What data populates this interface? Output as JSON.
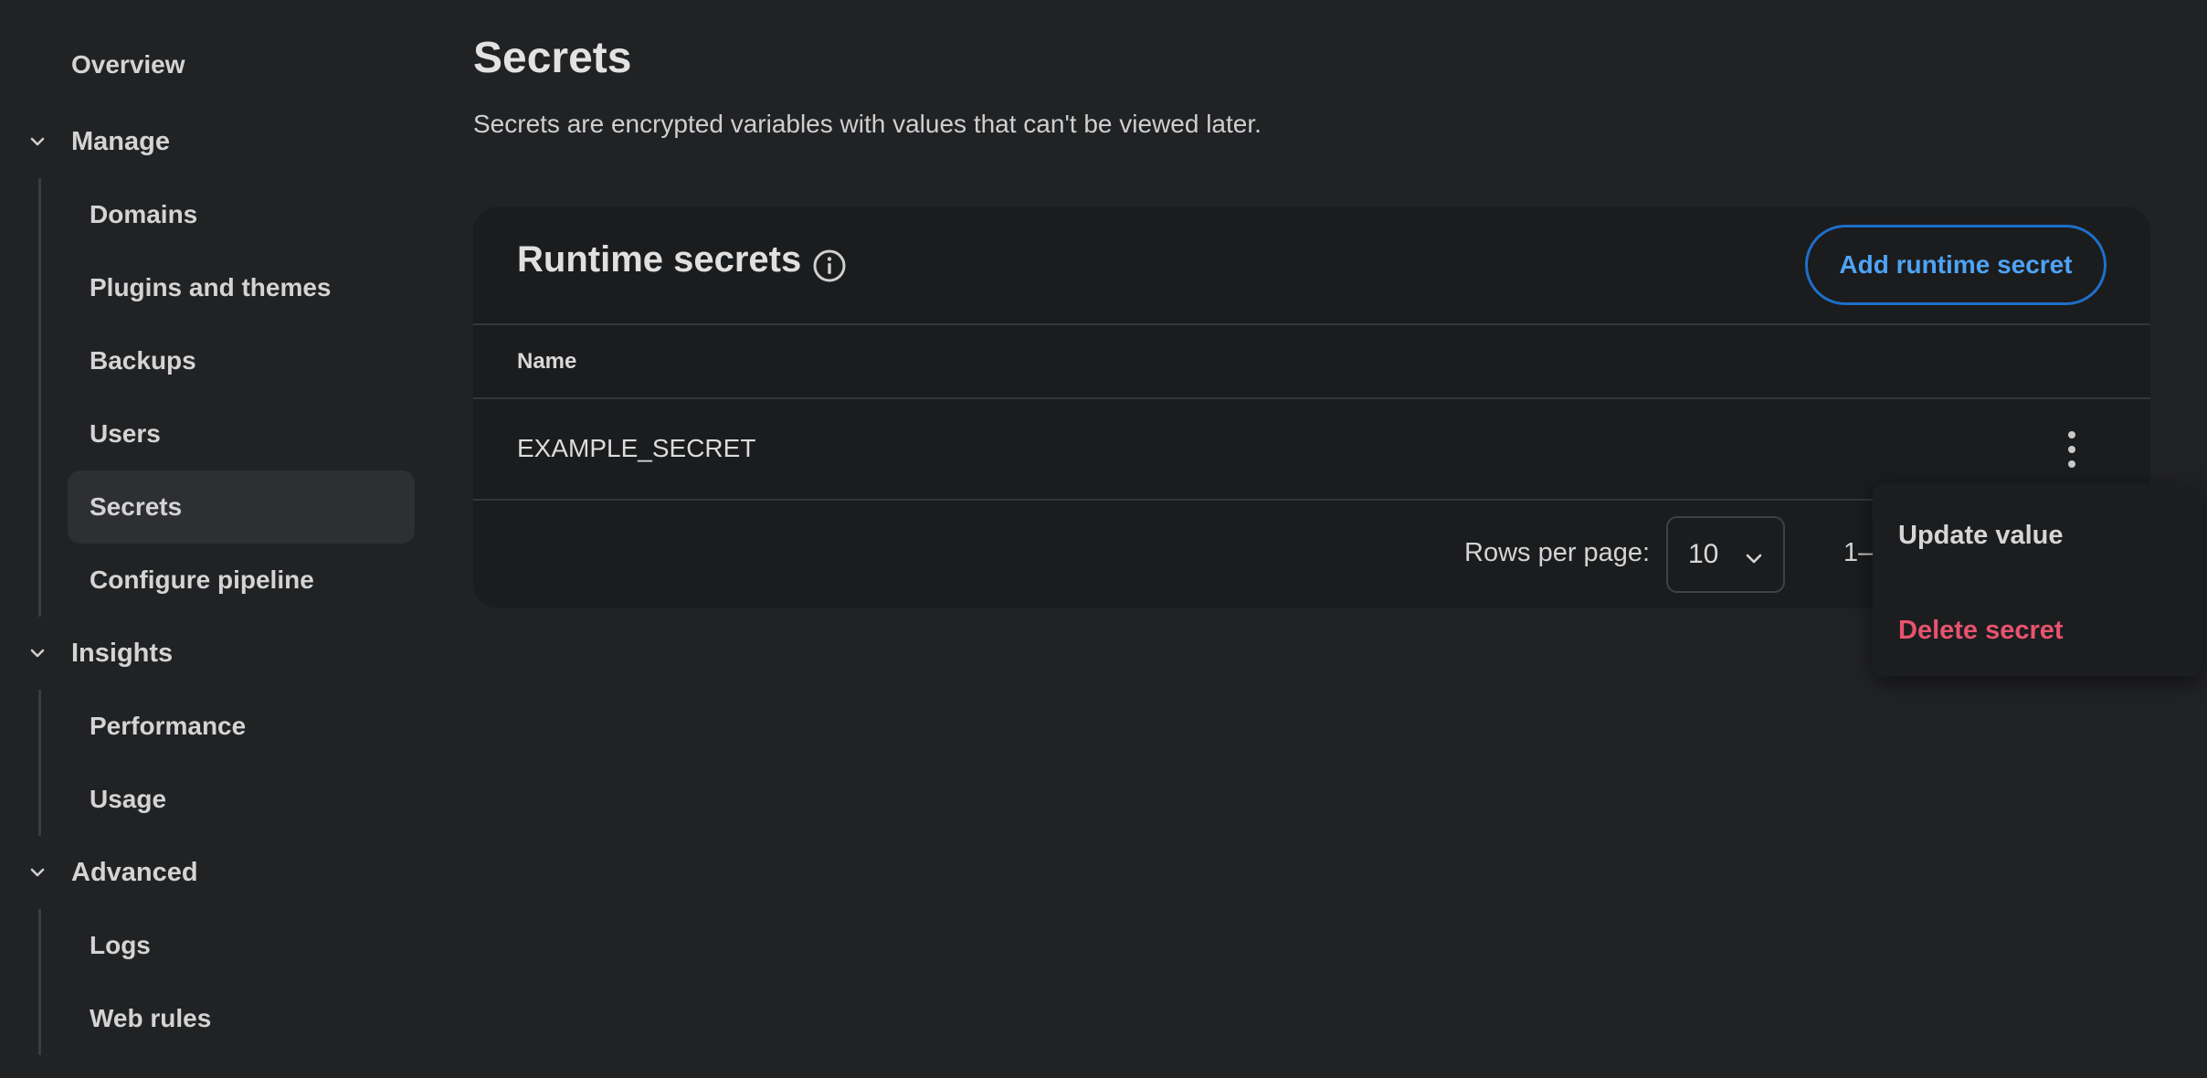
{
  "sidebar": {
    "overview": "Overview",
    "groups": [
      {
        "label": "Manage",
        "items": [
          "Domains",
          "Plugins and themes",
          "Backups",
          "Users",
          "Secrets",
          "Configure pipeline"
        ]
      },
      {
        "label": "Insights",
        "items": [
          "Performance",
          "Usage"
        ]
      },
      {
        "label": "Advanced",
        "items": [
          "Logs",
          "Web rules"
        ]
      }
    ],
    "active_item": "Secrets"
  },
  "page": {
    "title": "Secrets",
    "subtitle": "Secrets are encrypted variables with values that can't be viewed later."
  },
  "card": {
    "title": "Runtime secrets",
    "add_button": "Add runtime secret",
    "column_name": "Name",
    "rows": [
      {
        "name": "EXAMPLE_SECRET"
      }
    ],
    "pagination": {
      "rows_per_page_label": "Rows per page:",
      "rows_per_page_value": "10",
      "range_text": "1–1"
    }
  },
  "menu": {
    "update": "Update value",
    "delete": "Delete secret"
  },
  "colors": {
    "background": "#212224",
    "card": "#1b1c1e",
    "accent": "#4ea3f5",
    "danger": "#e8536e"
  }
}
